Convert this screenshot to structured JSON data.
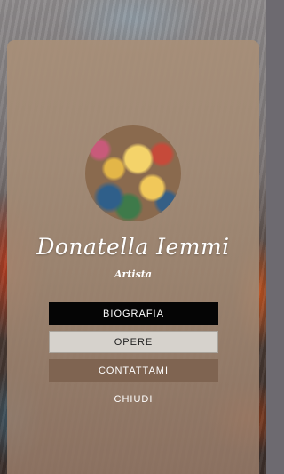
{
  "profile": {
    "name": "Donatella Iemmi",
    "role": "Artista"
  },
  "menu": {
    "items": [
      {
        "label": "BIOGRAFIA",
        "state": "active"
      },
      {
        "label": "OPERE",
        "state": "highlighted"
      },
      {
        "label": "CONTATTAMI",
        "state": "normal"
      },
      {
        "label": "CHIUDI",
        "state": "plain"
      }
    ]
  },
  "colors": {
    "card": "#a88f78",
    "active_button": "#050505",
    "light_button": "#d6d2cc",
    "brown_button": "#7f6451"
  }
}
